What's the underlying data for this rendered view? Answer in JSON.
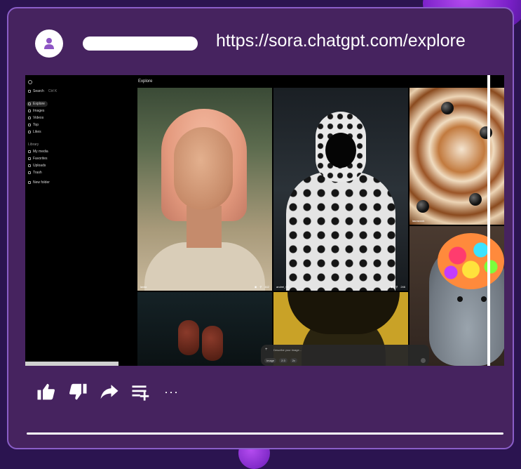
{
  "post": {
    "url": "https://sora.chatgpt.com/explore"
  },
  "sora": {
    "sidebar": {
      "search_label": "Search",
      "search_shortcut": "Ctrl K",
      "nav": [
        "Explore",
        "Images",
        "Videos",
        "Top",
        "Likes"
      ],
      "library_heading": "Library",
      "library": [
        "My media",
        "Favorites",
        "Uploads",
        "Trash"
      ],
      "new_folder": "New folder"
    },
    "page_title": "Explore",
    "tiles": [
      {
        "caption": "lavko",
        "likes": "442"
      },
      {
        "caption": "andrei_03",
        "likes": "246"
      },
      {
        "caption": "lauracook"
      }
    ],
    "prompt": {
      "placeholder": "Describe your image...",
      "chips": [
        "Image",
        "2:3",
        "2v"
      ]
    }
  },
  "actions": {
    "icons": [
      "thumbs-up-icon",
      "thumbs-down-icon",
      "share-icon",
      "add-to-playlist-icon",
      "more-icon"
    ],
    "more_label": "···"
  },
  "colors": {
    "background": "#2b1450",
    "card": "#46235f",
    "card_border": "#8a5ec8",
    "accent": "#b54cf0"
  }
}
